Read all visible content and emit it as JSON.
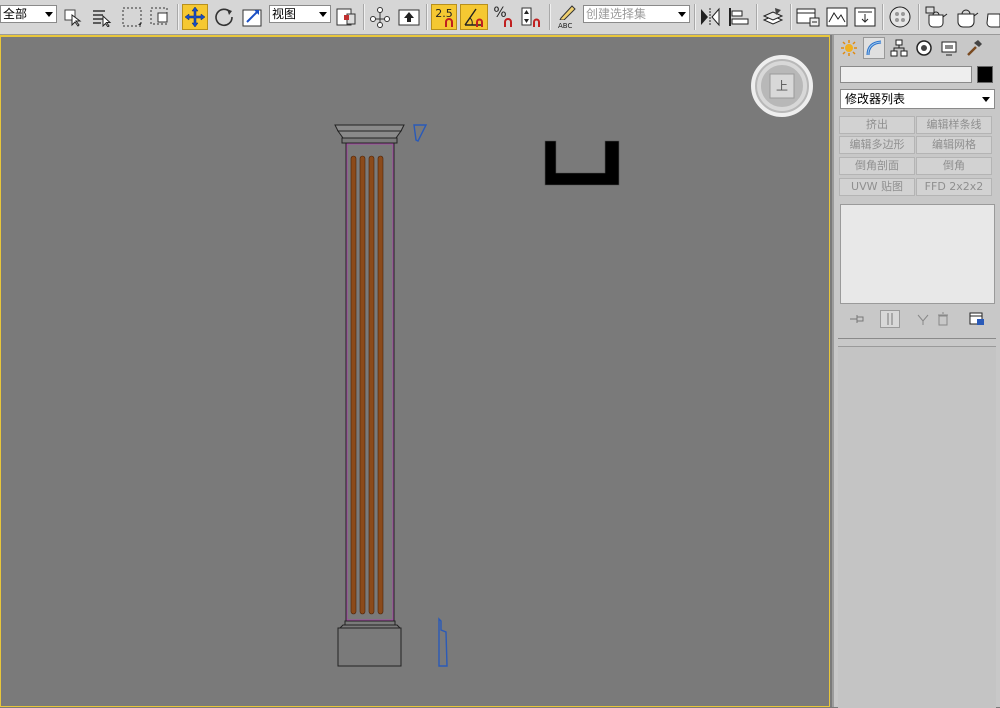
{
  "toolbar": {
    "selection_filter": "全部",
    "coord_system": "视图",
    "snap_label": "2.5",
    "percent_label": "%",
    "abc_label": "ABC",
    "named_selection_placeholder": "创建选择集"
  },
  "viewcube": {
    "face_label": "上"
  },
  "command_panel": {
    "modifier_list": "修改器列表",
    "modifier_buttons": [
      "挤出",
      "编辑样条线",
      "编辑多边形",
      "编辑网格",
      "倒角剖面",
      "倒角",
      "UVW 贴图",
      "FFD 2x2x2"
    ]
  },
  "colors": {
    "toolbar_bg": "#d6d6d6",
    "viewport_bg": "#7a7a7a",
    "active_yellow": "#f5c832",
    "column_flute": "#8b4a1a",
    "selection_magenta": "#b040b0",
    "shape_blue": "#2a5ab8"
  }
}
